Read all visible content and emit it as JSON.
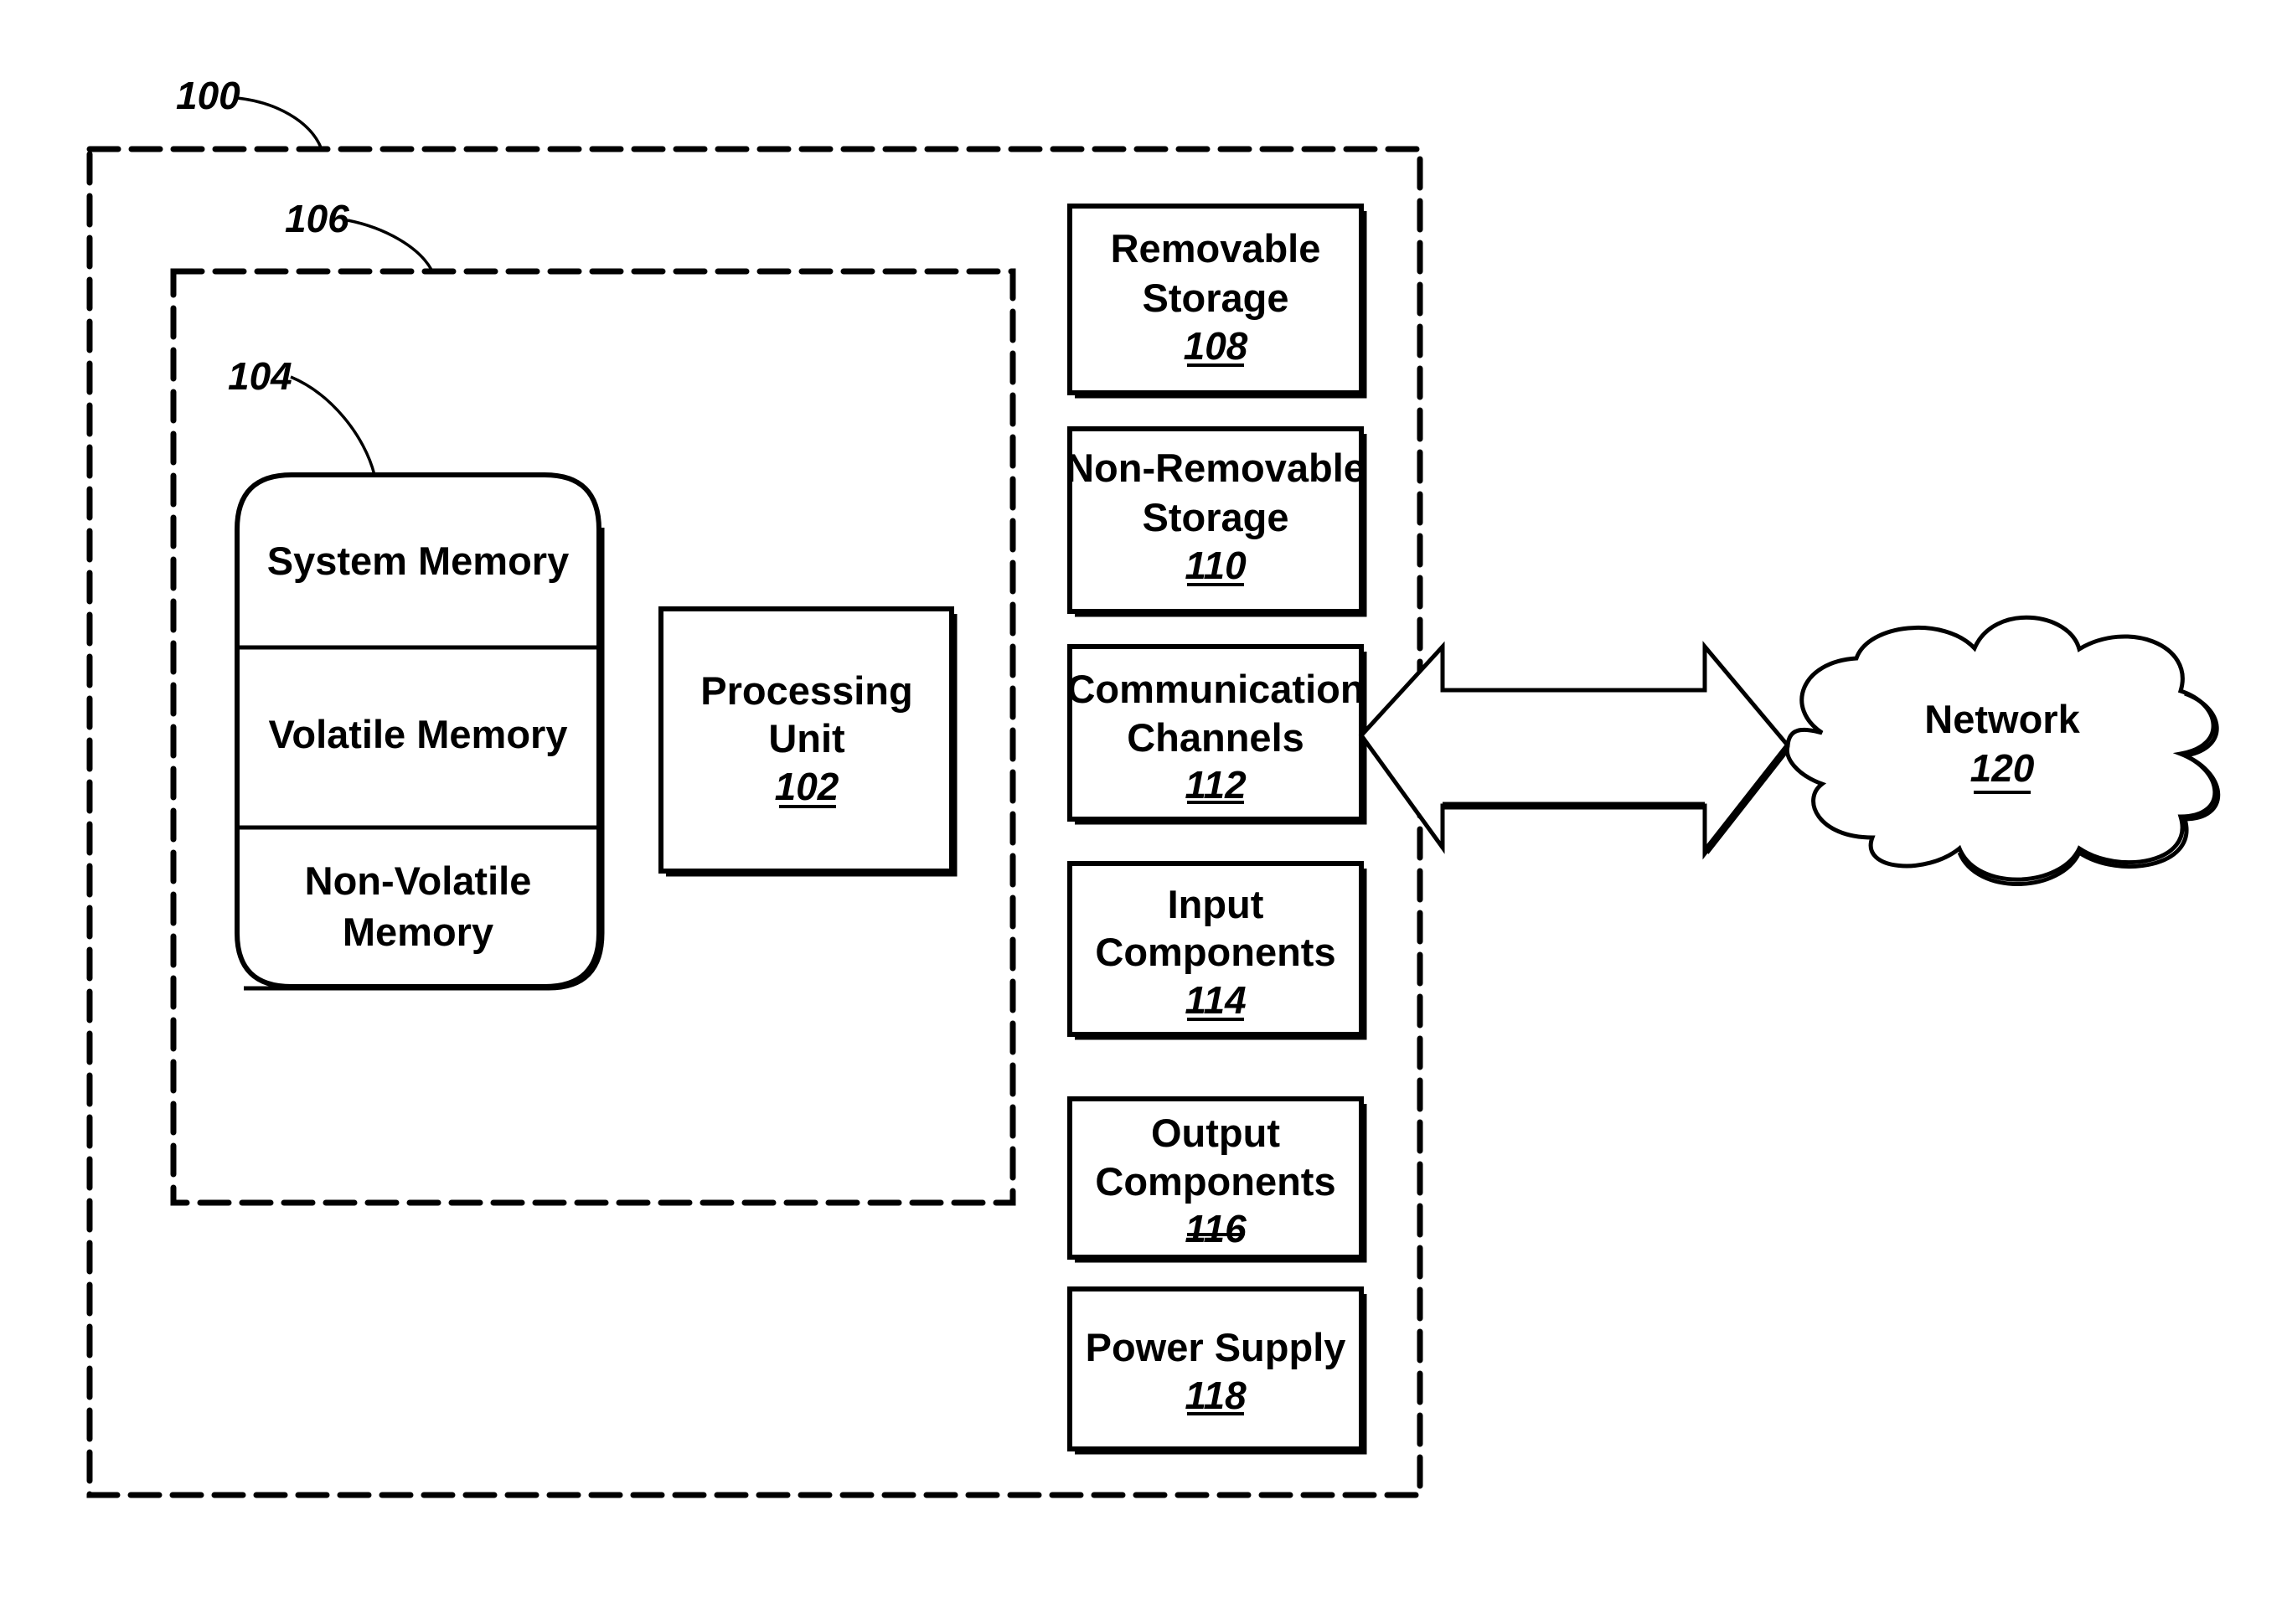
{
  "figure": {
    "system": {
      "ref": "100"
    },
    "core": {
      "ref": "106"
    },
    "memory": {
      "ref": "104",
      "sections": [
        {
          "lines": [
            "System Memory"
          ]
        },
        {
          "lines": [
            "Volatile Memory"
          ]
        },
        {
          "lines": [
            "Non-Volatile",
            "Memory"
          ]
        }
      ]
    },
    "processing_unit": {
      "lines": [
        "Processing",
        "Unit"
      ],
      "ref": "102"
    },
    "components": [
      {
        "lines": [
          "Removable",
          "Storage"
        ],
        "ref": "108"
      },
      {
        "lines": [
          "Non-Removable",
          "Storage"
        ],
        "ref": "110"
      },
      {
        "lines": [
          "Communication",
          "Channels"
        ],
        "ref": "112"
      },
      {
        "lines": [
          "Input",
          "Components"
        ],
        "ref": "114"
      },
      {
        "lines": [
          "Output",
          "Components"
        ],
        "ref": "116"
      },
      {
        "lines": [
          "Power Supply"
        ],
        "ref": "118"
      }
    ],
    "network": {
      "lines": [
        "Network"
      ],
      "ref": "120"
    },
    "connection": {
      "type": "bidirectional",
      "from": "Communication Channels",
      "to": "Network"
    }
  }
}
